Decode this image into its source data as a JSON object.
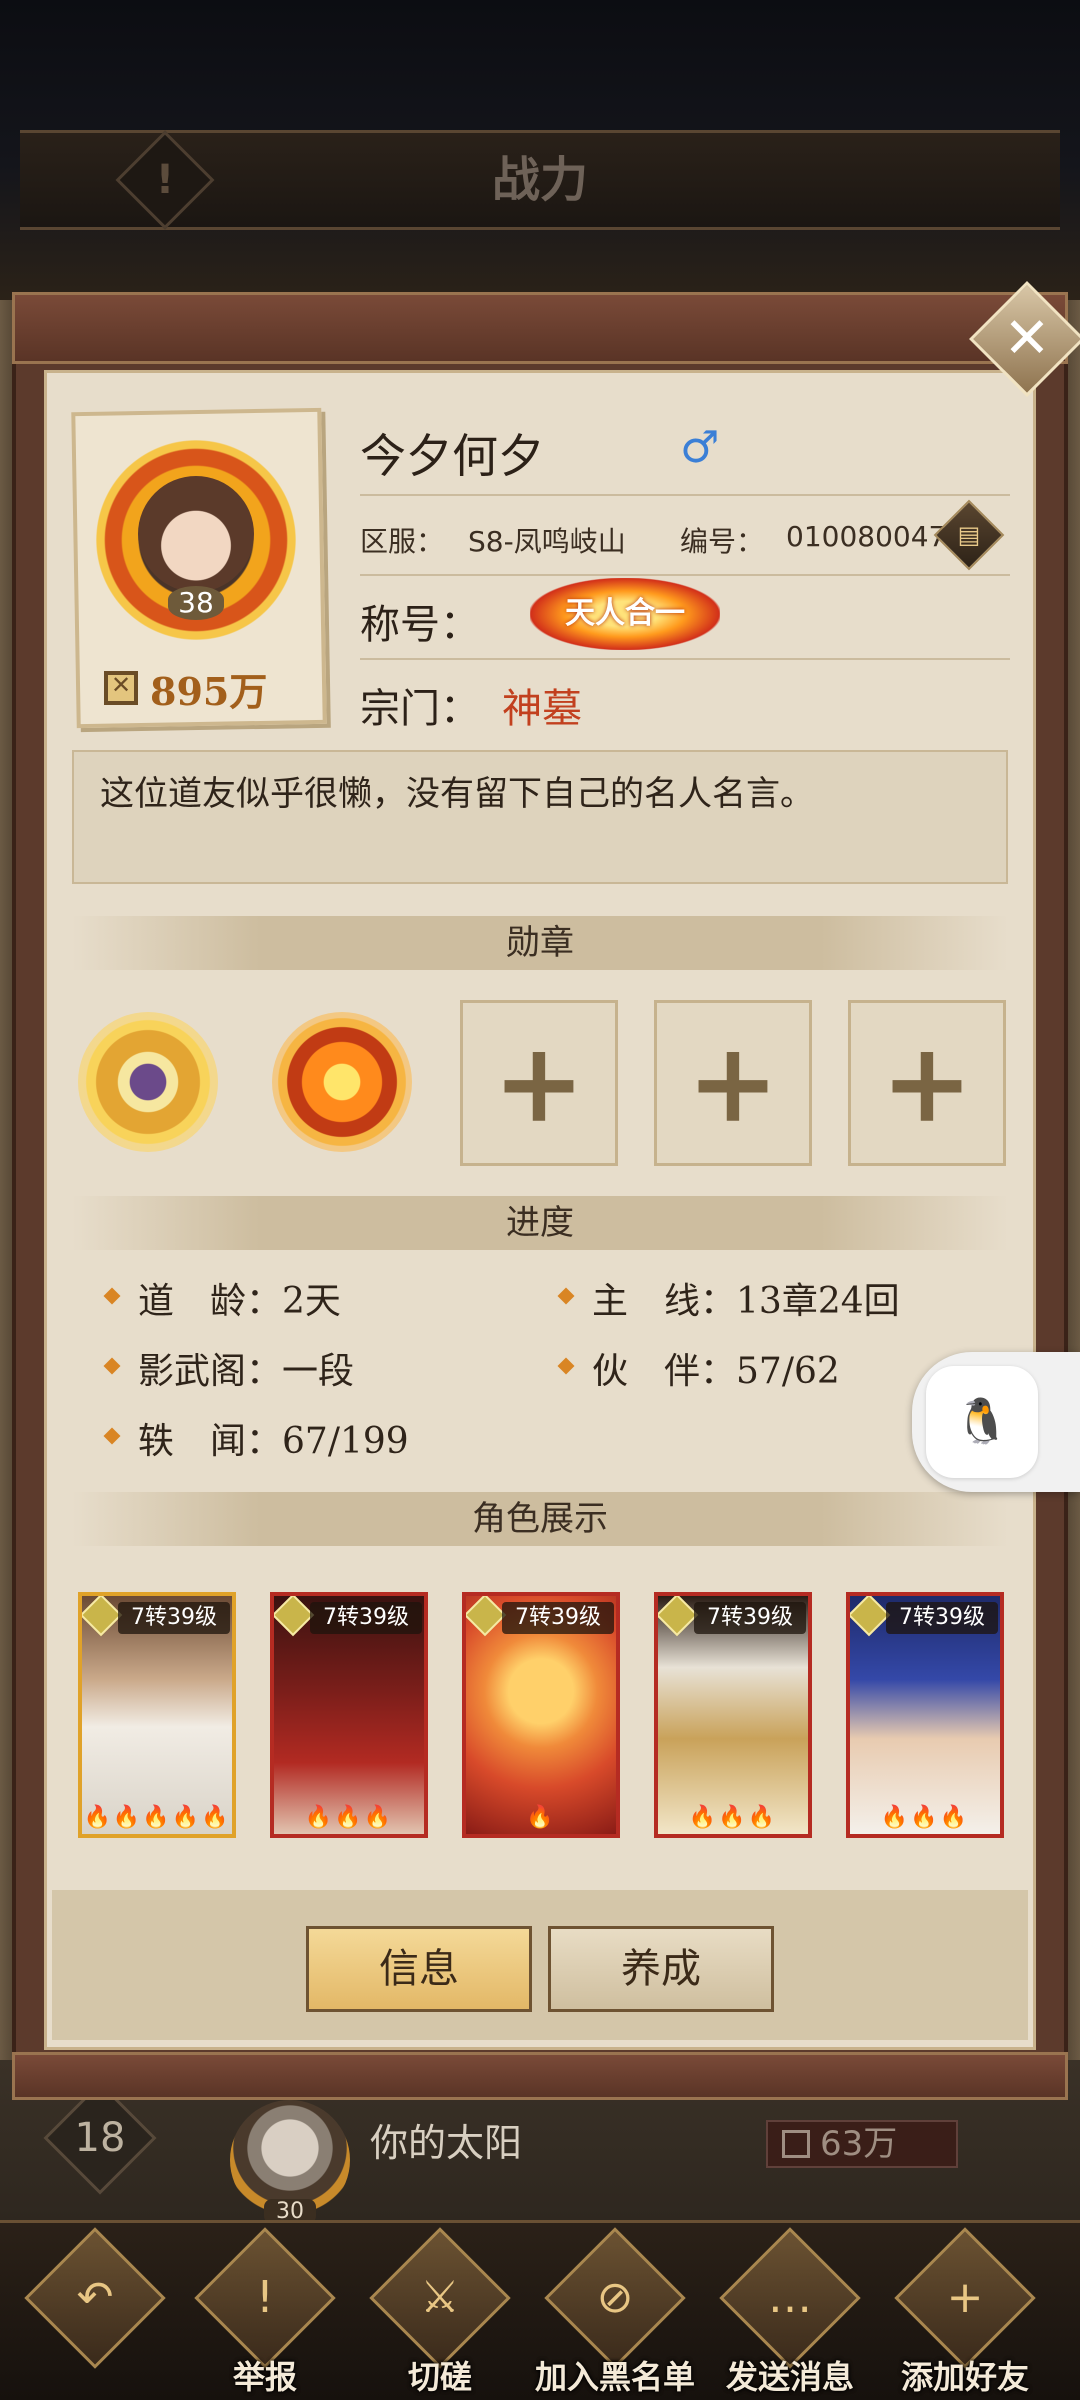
{
  "screen": {
    "title": "战力"
  },
  "modal": {
    "close_icon": "close-icon"
  },
  "profile": {
    "name": "今夕何夕",
    "gender_symbol": "♂",
    "level": "38",
    "power": "895万",
    "server_label": "区服：",
    "server": "S8-凤鸣岐山",
    "id_label": "编号：",
    "id": "010080047",
    "title_label": "称号：",
    "title_badge": "天人合一",
    "sect_label": "宗门：",
    "sect": "神墓",
    "motto": "这位道友似乎很懒，没有留下自己的名人名言。"
  },
  "sections": {
    "medals": "勋章",
    "progress": "进度",
    "roles": "角色展示"
  },
  "medal_slots": [
    {
      "label": "+"
    },
    {
      "label": "+"
    },
    {
      "label": "+"
    }
  ],
  "progress": [
    {
      "label": "道　龄：",
      "value": "2天"
    },
    {
      "label": "主　线：",
      "value": "13章24回"
    },
    {
      "label": "影武阁：",
      "value": "一段"
    },
    {
      "label": "伙　伴：",
      "value": "57/62"
    },
    {
      "label": "轶　闻：",
      "value": "67/199"
    }
  ],
  "heroes": [
    {
      "level": "7转39级",
      "flames": "🔥🔥🔥🔥🔥",
      "frame": "gold"
    },
    {
      "level": "7转39级",
      "flames": "🔥🔥🔥",
      "frame": "red"
    },
    {
      "level": "7转39级",
      "flames": "🔥",
      "frame": "red"
    },
    {
      "level": "7转39级",
      "flames": "🔥🔥🔥",
      "frame": "red"
    },
    {
      "level": "7转39级",
      "flames": "🔥🔥🔥",
      "frame": "red"
    }
  ],
  "buttons": {
    "info": "信息",
    "grow": "养成"
  },
  "background_list": {
    "rank": "18",
    "avatar_level": "30",
    "name": "你的太阳",
    "power": "63万"
  },
  "actions": [
    {
      "label": "举报",
      "icon": "warning-icon"
    },
    {
      "label": "切磋",
      "icon": "crossed-swords-icon"
    },
    {
      "label": "加入黑名单",
      "icon": "block-user-icon"
    },
    {
      "label": "发送消息",
      "icon": "chat-icon"
    },
    {
      "label": "添加好友",
      "icon": "add-friend-icon"
    }
  ]
}
